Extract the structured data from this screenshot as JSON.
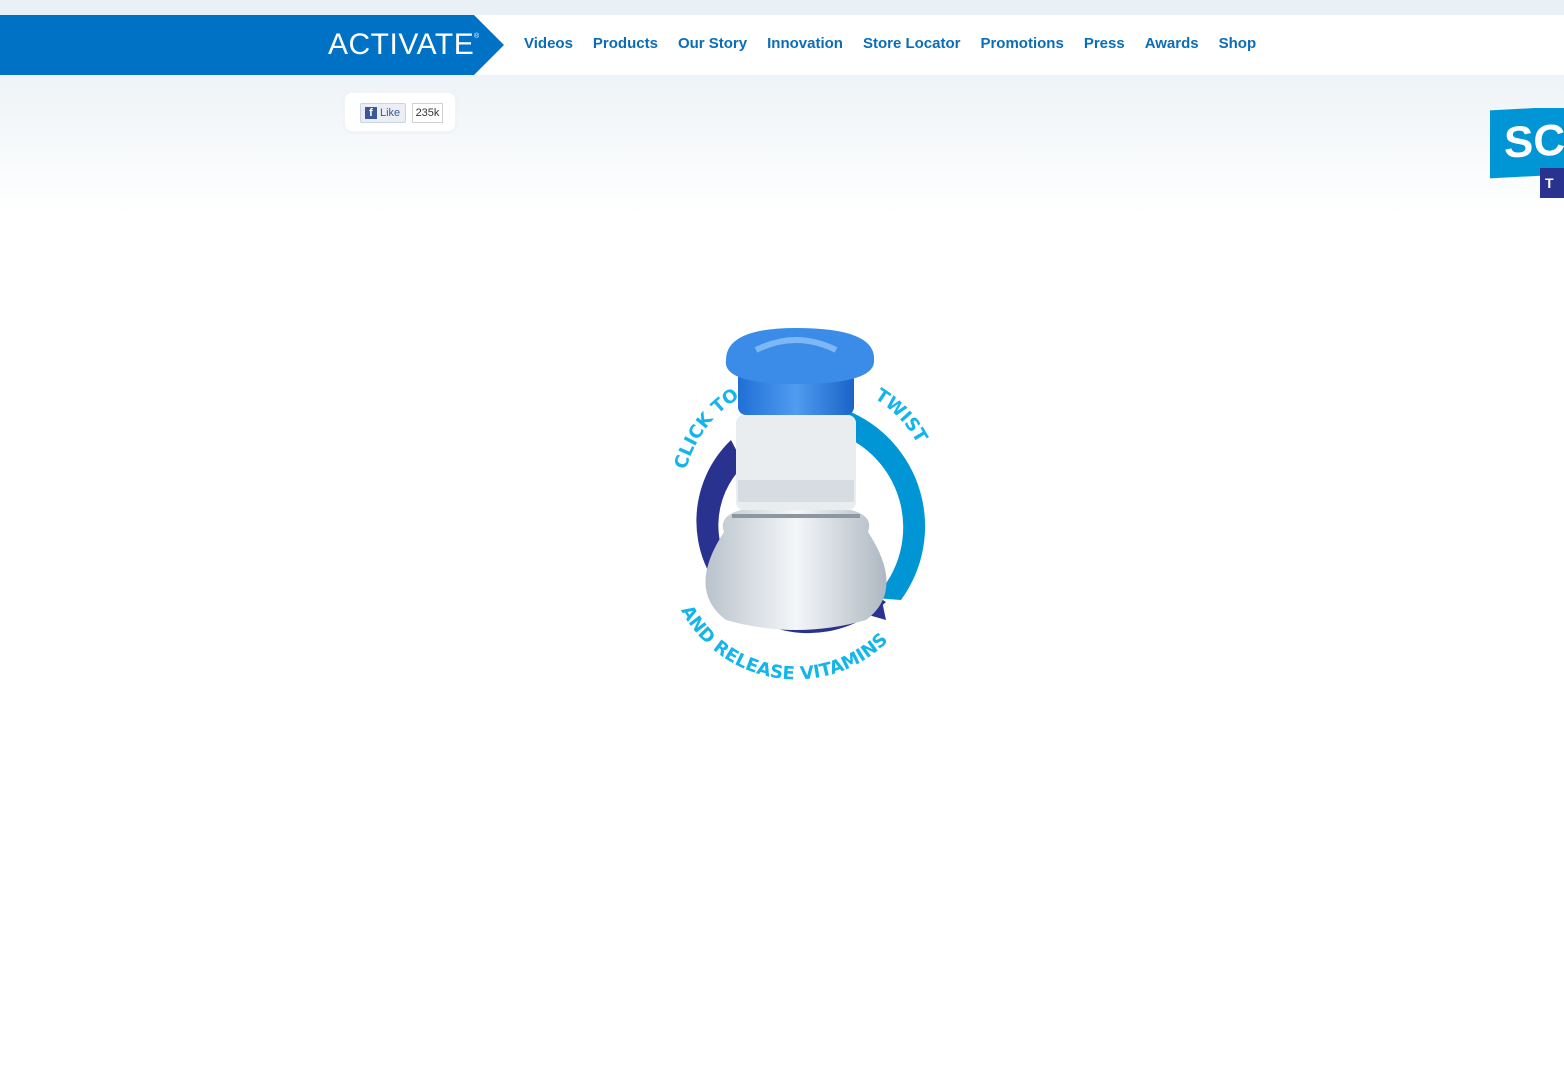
{
  "brand": {
    "logo_text": "ACTIVATE",
    "logo_mark": "®"
  },
  "nav": {
    "items": [
      {
        "label": "Videos"
      },
      {
        "label": "Products"
      },
      {
        "label": "Our Story"
      },
      {
        "label": "Innovation"
      },
      {
        "label": "Store Locator"
      },
      {
        "label": "Promotions"
      },
      {
        "label": "Press"
      },
      {
        "label": "Awards"
      },
      {
        "label": "Shop"
      }
    ]
  },
  "facebook": {
    "like_label": "Like",
    "like_count": "235k",
    "icon": "facebook-icon"
  },
  "promo": {
    "badge_text": "SC",
    "badge_sub": "T"
  },
  "hero": {
    "text_top_left": "CLICK TO",
    "text_top_right": "TWIST",
    "text_bottom": "AND RELEASE VITAMINS"
  },
  "colors": {
    "brand_blue": "#0072c6",
    "nav_text": "#0a6db7",
    "arrow_dark": "#2a3290",
    "arrow_light": "#0096d6",
    "text_cyan": "#13b5ea"
  }
}
